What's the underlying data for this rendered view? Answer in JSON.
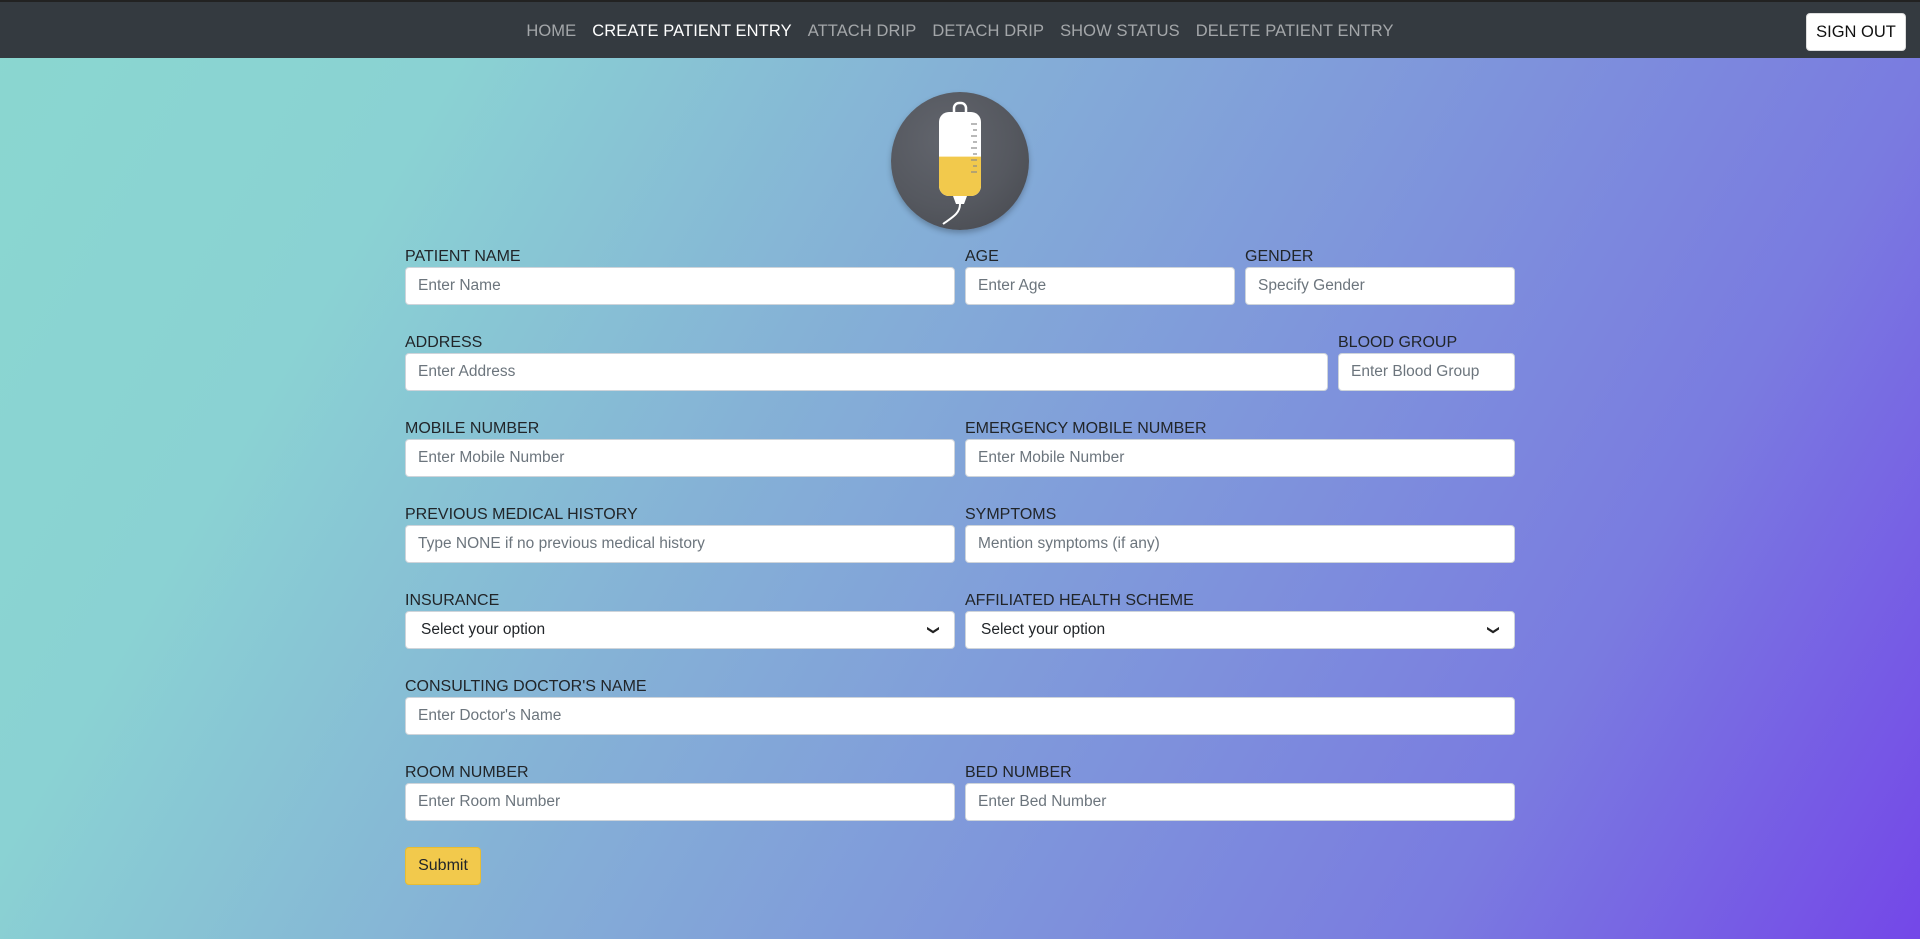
{
  "nav": {
    "links": [
      "HOME",
      "CREATE PATIENT ENTRY",
      "ATTACH DRIP",
      "DETACH DRIP",
      "SHOW STATUS",
      "DELETE PATIENT ENTRY"
    ],
    "active": "CREATE PATIENT ENTRY",
    "signout_label": "SIGN OUT"
  },
  "logo": {
    "icon": "iv-drip-bag-icon",
    "fill_level": 0.35,
    "fill_color": "#f2c94c"
  },
  "form": {
    "patient_name": {
      "label": "PATIENT NAME",
      "placeholder": "Enter Name"
    },
    "age": {
      "label": "AGE",
      "placeholder": "Enter Age"
    },
    "gender": {
      "label": "GENDER",
      "placeholder": "Specify Gender"
    },
    "address": {
      "label": "ADDRESS",
      "placeholder": "Enter Address"
    },
    "blood_group": {
      "label": "BLOOD GROUP",
      "placeholder": "Enter Blood Group"
    },
    "mobile": {
      "label": "MOBILE NUMBER",
      "placeholder": "Enter Mobile Number"
    },
    "emergency_mobile": {
      "label": "EMERGENCY MOBILE NUMBER",
      "placeholder": "Enter Mobile Number"
    },
    "medical_history": {
      "label": "PREVIOUS MEDICAL HISTORY",
      "placeholder": "Type NONE if no previous medical history"
    },
    "symptoms": {
      "label": "SYMPTOMS",
      "placeholder": "Mention symptoms (if any)"
    },
    "insurance": {
      "label": "INSURANCE",
      "value": "Select your option"
    },
    "health_scheme": {
      "label": "AFFILIATED HEALTH SCHEME",
      "value": "Select your option"
    },
    "doctor": {
      "label": "CONSULTING DOCTOR'S NAME",
      "placeholder": "Enter Doctor's Name"
    },
    "room": {
      "label": "ROOM NUMBER",
      "placeholder": "Enter Room Number"
    },
    "bed": {
      "label": "BED NUMBER",
      "placeholder": "Enter Bed Number"
    },
    "submit_label": "Submit"
  },
  "colors": {
    "navbar": "#343a40",
    "accent": "#f2c94c",
    "gradient_start": "#8ad7d0",
    "gradient_end": "#7447e8"
  }
}
